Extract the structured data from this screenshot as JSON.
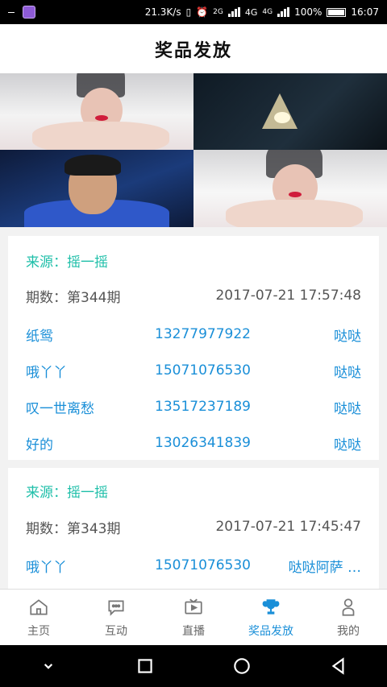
{
  "status": {
    "network_speed": "21.3K/s",
    "signal1": "2G",
    "signal2": "4G",
    "signal3": "4G",
    "battery": "100%",
    "time": "16:07"
  },
  "header": {
    "title": "奖品发放"
  },
  "records": [
    {
      "source": "来源：摇一摇",
      "period": "期数：第344期",
      "datetime": "2017-07-21 17:57:48",
      "winners": [
        {
          "name": "纸鸳",
          "phone": "13277977922",
          "prize": "哒哒"
        },
        {
          "name": "哦丫丫",
          "phone": "15071076530",
          "prize": "哒哒"
        },
        {
          "name": "叹一世离愁",
          "phone": "13517237189",
          "prize": "哒哒"
        },
        {
          "name": "好的",
          "phone": "13026341839",
          "prize": "哒哒"
        }
      ]
    },
    {
      "source": "来源：摇一摇",
      "period": "期数：第343期",
      "datetime": "2017-07-21 17:45:47",
      "winners": [
        {
          "name": "哦丫丫",
          "phone": "15071076530",
          "prize": "哒哒阿萨 …"
        }
      ]
    }
  ],
  "tabs": [
    {
      "label": "主页",
      "icon": "home-icon"
    },
    {
      "label": "互动",
      "icon": "chat-icon"
    },
    {
      "label": "直播",
      "icon": "tv-icon"
    },
    {
      "label": "奖品发放",
      "icon": "trophy-icon",
      "active": true
    },
    {
      "label": "我的",
      "icon": "person-icon"
    }
  ],
  "colors": {
    "accent": "#1a8fd8",
    "source": "#1fbfa9"
  }
}
